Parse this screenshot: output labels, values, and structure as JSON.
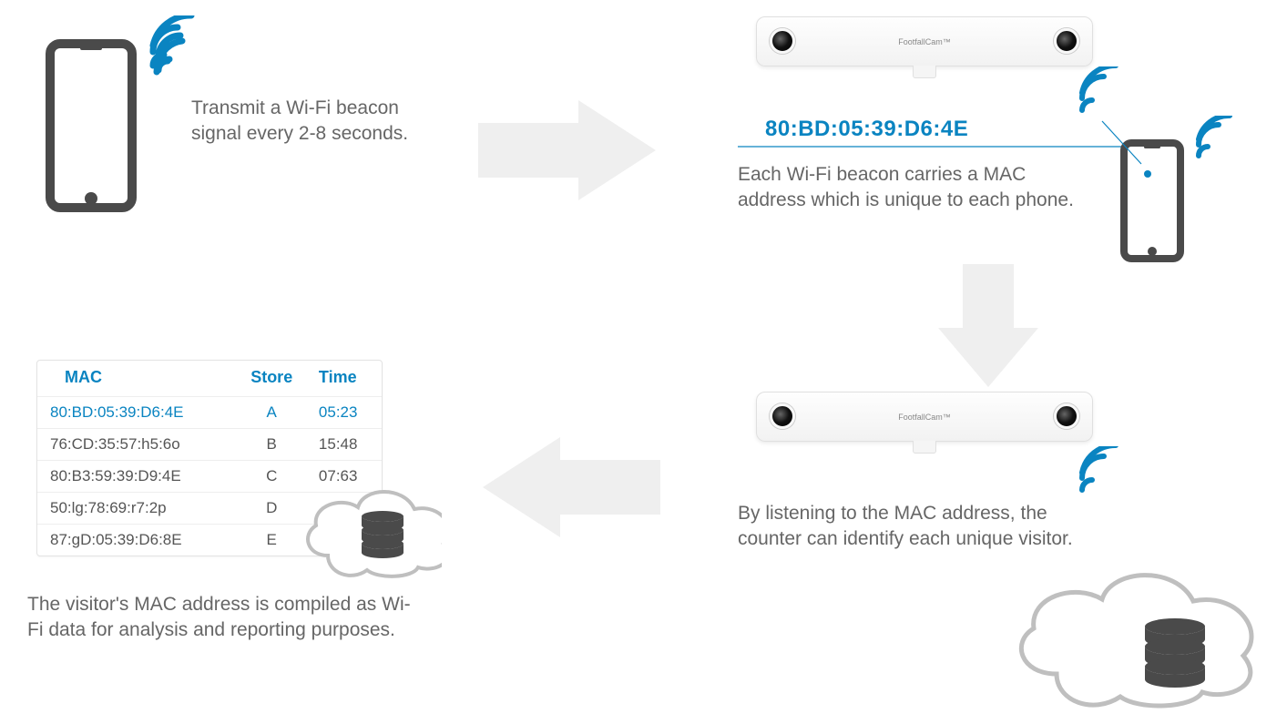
{
  "colors": {
    "accent": "#0a84c1",
    "text": "#666666",
    "arrow": "#efefef",
    "icon_dark": "#4a4a4a"
  },
  "stage1": {
    "desc": "Transmit a Wi-Fi beacon signal every 2-8 seconds."
  },
  "stage2": {
    "device_label": "FootfallCam™",
    "mac": "80:BD:05:39:D6:4E",
    "desc": "Each Wi-Fi beacon carries a MAC address which is unique to each phone."
  },
  "stage3": {
    "device_label": "FootfallCam™",
    "desc": "By listening to the MAC address, the counter can identify each unique visitor."
  },
  "stage4": {
    "desc": "The visitor's MAC address is compiled as Wi-Fi data for analysis and reporting purposes.",
    "table": {
      "headers": [
        "MAC",
        "Store",
        "Time"
      ],
      "rows": [
        {
          "mac": "80:BD:05:39:D6:4E",
          "store": "A",
          "time": "05:23"
        },
        {
          "mac": "76:CD:35:57:h5:6o",
          "store": "B",
          "time": "15:48"
        },
        {
          "mac": "80:B3:59:39:D9:4E",
          "store": "C",
          "time": "07:63"
        },
        {
          "mac": "50:lg:78:69:r7:2p",
          "store": "D",
          "time": ""
        },
        {
          "mac": "87:gD:05:39:D6:8E",
          "store": "E",
          "time": ""
        }
      ]
    }
  }
}
